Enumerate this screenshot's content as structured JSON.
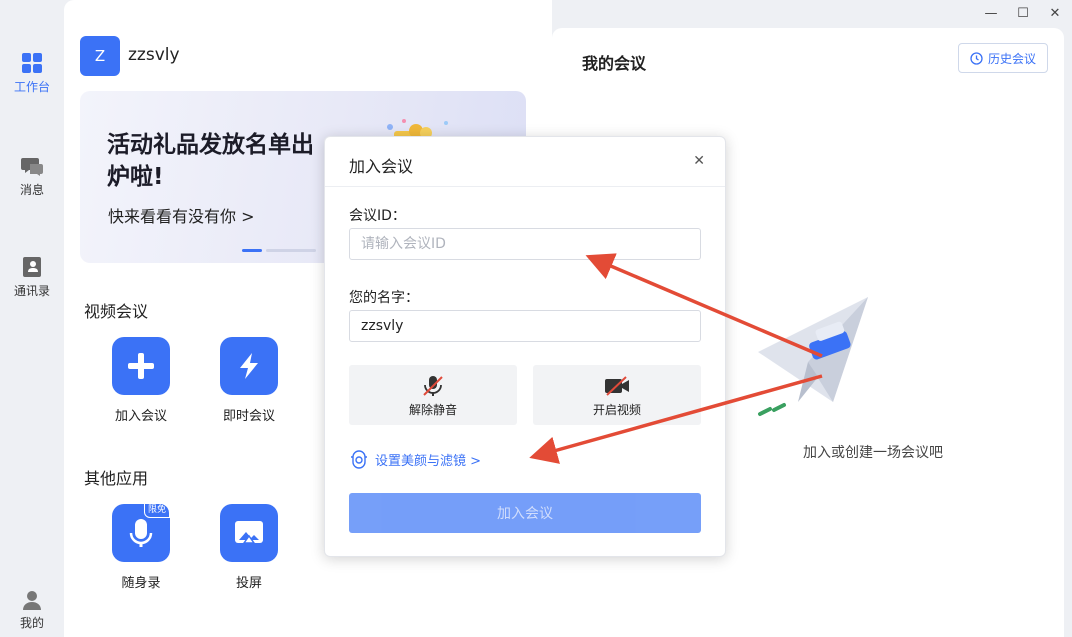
{
  "window": {
    "minimize": "—",
    "maximize": "☐",
    "close": "✕"
  },
  "rail": {
    "items": [
      {
        "label": "工作台",
        "icon": "grid-icon",
        "active": true
      },
      {
        "label": "消息",
        "icon": "chat-icon"
      },
      {
        "label": "通讯录",
        "icon": "contacts-icon"
      },
      {
        "label": "我的",
        "icon": "user-icon"
      }
    ]
  },
  "user": {
    "avatar_letter": "Z",
    "name": "zzsvly"
  },
  "banner": {
    "title": "活动礼品发放名单出炉啦!",
    "subtitle": "快来看看有没有你 >"
  },
  "video_section": {
    "title": "视频会议",
    "apps": [
      {
        "label": "加入会议",
        "icon": "plus-icon"
      },
      {
        "label": "即时会议",
        "icon": "lightning-icon"
      }
    ]
  },
  "other_section": {
    "title": "其他应用",
    "apps": [
      {
        "label": "随身录",
        "icon": "microphone-icon",
        "badge": "限免"
      },
      {
        "label": "投屏",
        "icon": "screen-cast-icon"
      }
    ]
  },
  "right_panel": {
    "title": "我的会议",
    "history_button": "历史会议",
    "empty_text": "加入或创建一场会议吧"
  },
  "modal": {
    "title": "加入会议",
    "close": "✕",
    "meeting_id_label": "会议ID：",
    "meeting_id_placeholder": "请输入会议ID",
    "name_label": "您的名字：",
    "name_value": "zzsvly",
    "unmute_label": "解除静音",
    "video_label": "开启视频",
    "beauty_link": "设置美颜与滤镜 >",
    "join_button": "加入会议"
  },
  "colors": {
    "accent": "#3b72f6",
    "arrow": "#e34b36"
  }
}
